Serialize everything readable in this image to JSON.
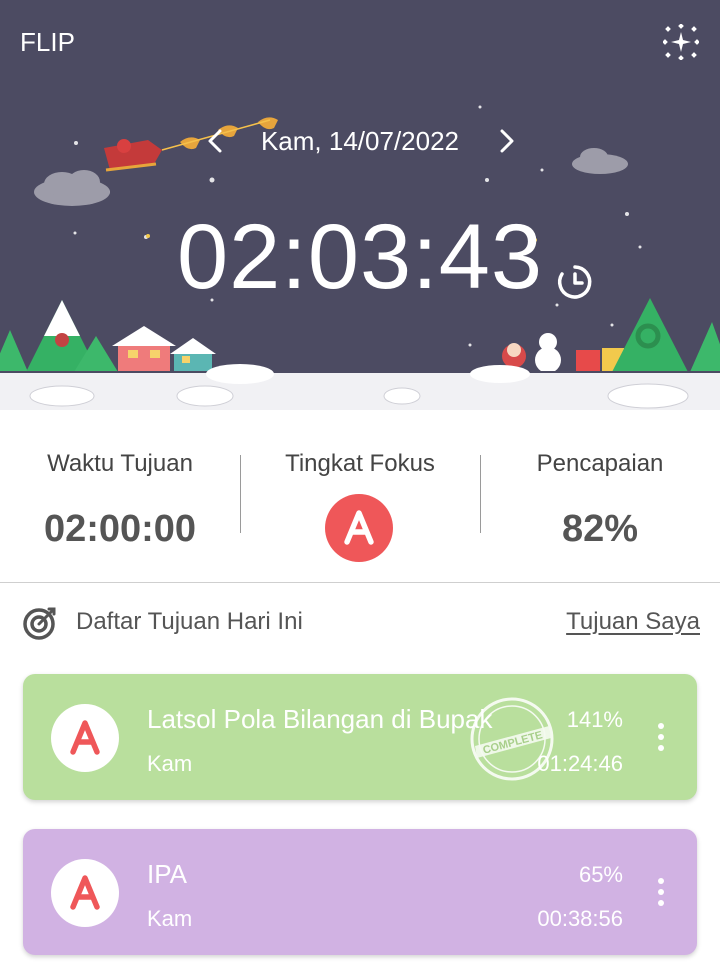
{
  "app": {
    "title": "FLIP"
  },
  "date": {
    "label": "Kam, 14/07/2022"
  },
  "clock": {
    "time": "02:03:43"
  },
  "stats": {
    "target_label": "Waktu Tujuan",
    "target_value": "02:00:00",
    "focus_label": "Tingkat Fokus",
    "focus_grade": "A",
    "achievement_label": "Pencapaian",
    "achievement_value": "82%"
  },
  "goals": {
    "title": "Daftar Tujuan Hari Ini",
    "link": "Tujuan Saya",
    "items": [
      {
        "title": "Latsol Pola Bilangan di Bupak",
        "day": "Kam",
        "percent": "141%",
        "time": "01:24:46",
        "grade": "A",
        "stamp": "COMPLETE",
        "color": "#b9df9d"
      },
      {
        "title": "IPA",
        "day": "Kam",
        "percent": "65%",
        "time": "00:38:56",
        "grade": "A",
        "color": "#d1b2e3"
      }
    ]
  },
  "colors": {
    "header_bg": "#4c4b62",
    "grade_red": "#ef5759",
    "card_green": "#b9df9d",
    "card_purple": "#d1b2e3"
  },
  "icons": [
    "sparkle-icon",
    "chevron-left-icon",
    "chevron-right-icon",
    "timer-icon",
    "target-icon",
    "more-vertical-icon"
  ]
}
